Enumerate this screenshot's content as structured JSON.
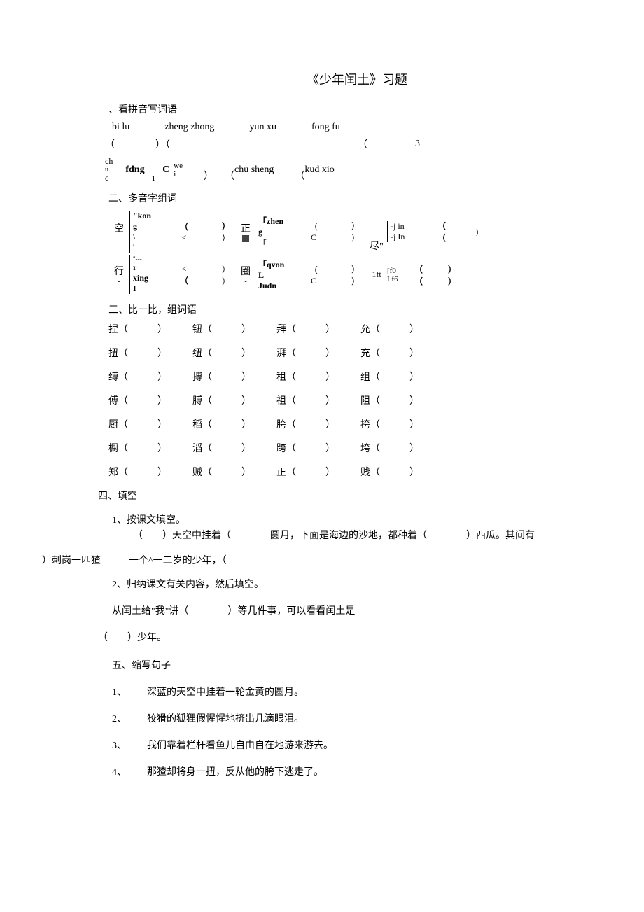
{
  "title": "《少年闰土》习题",
  "section1": {
    "header": "、看拼音写词语",
    "r1": [
      "bi lu",
      "zheng zhong",
      "yun xu",
      "fong fu"
    ],
    "r2_open": "（",
    "r2_mid": "）（",
    "r2_open2": "（",
    "r2_3": "3",
    "r3_ch": "ch",
    "r3_u": "u",
    "r3_c": "c",
    "r3_fdng": "fdng",
    "r3_1": "1",
    "r3_C": "C",
    "r3_we": "we",
    "r3_i": "i",
    "r3_paren": "）",
    "r3_open": "（",
    "r3_chu": "chu sheng",
    "r3_open2": "（",
    "r3_kud": "kud xio"
  },
  "section2": {
    "header": "二、多音字组词",
    "char1": "空",
    "char1_sub": "-",
    "p1a": "\"kon",
    "p1b": "g",
    "p1c": "\\",
    "p1d": "'",
    "lp": "（",
    "lt": "<",
    "rp": "）",
    "char2": "正",
    "p2a": "「zhen",
    "p2b": "g",
    "p2c": "「",
    "capC": "C",
    "char3": "尽\"",
    "p3a": "-j in",
    "p3b": "-j In",
    "rp2": "）",
    "char4": "行",
    "char4_sub": "-",
    "p4a": "\"---",
    "p4b": "r",
    "p4c": "xing",
    "p4d": "I",
    "char5": "圈",
    "char5_sub": "-",
    "p5a": "「qvon",
    "p5b": "L",
    "p5c": "Judn",
    "oneft": "1ft",
    "f0": "[f0",
    "If6": "I f6"
  },
  "section3": {
    "header": "三、比一比，组词语",
    "rows": [
      [
        "捏（",
        "）",
        "钮（",
        "）",
        "拜（",
        "）",
        "允（",
        "）"
      ],
      [
        "扭（",
        "）",
        "纽（",
        "）",
        "湃（",
        "）",
        "充（",
        "）"
      ],
      [
        "缚（",
        "）",
        "搏（",
        "）",
        "租（",
        "）",
        "组（",
        "）"
      ],
      [
        "傅（",
        "）",
        "膊（",
        "）",
        "祖（",
        "）",
        "阻（",
        "）"
      ],
      [
        "厨（",
        "）",
        "稻（",
        "）",
        "胯（",
        "）",
        "挎（",
        "）"
      ],
      [
        "橱（",
        "）",
        "滔（",
        "）",
        "跨（",
        "）",
        "垮（",
        "）"
      ],
      [
        "郑（",
        "）",
        "贼（",
        "）",
        "正（",
        "）",
        "贱（",
        "）"
      ]
    ]
  },
  "section4": {
    "header": "四、填空",
    "q1_label": "1、按课文填空。",
    "q1_text_a": "（　　）天空中挂着（　　　　圆月，下面是海边的沙地，都种着（　　　　）西瓜。其间有",
    "q1_frag_left": "）刺岗一匹猹",
    "q1_frag_mid": "一个^一二岁的少年，（",
    "q2_label": "2、归纳课文有关内容，然后填空。",
    "q2_text_a": "从闰土给\"我\"讲（　　　　）等几件事，可以看看闰土是",
    "q2_text_b": "（　　）少年。"
  },
  "section5": {
    "header": "五、缩写句子",
    "items": [
      {
        "n": "1、",
        "t": "深蓝的天空中挂着一轮金黄的圆月。"
      },
      {
        "n": "2、",
        "t": "狡猾的狐狸假惺惺地挤出几滴眼泪。"
      },
      {
        "n": "3、",
        "t": "我们靠着栏杆看鱼儿自由自在地游来游去。"
      },
      {
        "n": "4、",
        "t": "那猹却将身一扭，反从他的胯下逃走了。"
      }
    ]
  }
}
